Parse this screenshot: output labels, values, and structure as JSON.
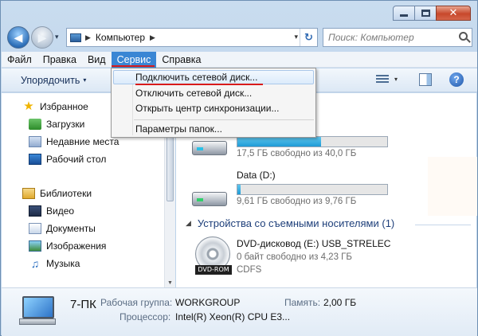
{
  "window": {
    "caption_min": "",
    "caption_max": "",
    "caption_close": "✕"
  },
  "nav": {
    "back_glyph": "◀",
    "fwd_glyph": "▶",
    "history_glyph": "▾",
    "address": {
      "path_sep": "▶",
      "location": "Компьютер",
      "after_sep": "▶",
      "drop_glyph": "▾"
    },
    "refresh_glyph": "↻",
    "search": {
      "placeholder": "Поиск: Компьютер"
    }
  },
  "menubar": {
    "items": [
      {
        "label": "Файл"
      },
      {
        "label": "Правка"
      },
      {
        "label": "Вид"
      },
      {
        "label": "Сервис"
      },
      {
        "label": "Справка"
      }
    ]
  },
  "toolbar": {
    "organize_label": "Упорядочить",
    "organize_arrow": "▾",
    "view_drop": "▾",
    "help_label": "?"
  },
  "navpane": {
    "favorites": "Избранное",
    "downloads": "Загрузки",
    "recent": "Недавние места",
    "desktop": "Рабочий стол",
    "libraries": "Библиотеки",
    "video": "Видео",
    "documents": "Документы",
    "images": "Изображения",
    "music": "Музыка",
    "star_glyph": "★",
    "music_glyph": "♫",
    "scroll_up": "▲",
    "scroll_down": "▼"
  },
  "content": {
    "drive_c": {
      "free_text": "17,5 ГБ свободно из 40,0 ГБ",
      "used_fraction": 0.56
    },
    "drive_d": {
      "label": "Data (D:)",
      "free_text": "9,61 ГБ свободно из 9,76 ГБ",
      "used_fraction": 0.02
    },
    "removable_header": "Устройства со съемными носителями (1)",
    "group_arrow": "◢",
    "dvd": {
      "label": "DVD-дисковод (E:) USB_STRELEC",
      "free_text": "0 байт свободно из 4,23 ГБ",
      "fs": "CDFS",
      "tag": "DVD-ROM"
    }
  },
  "dropdown": {
    "items": [
      {
        "label": "Подключить сетевой диск..."
      },
      {
        "label": "Отключить сетевой диск..."
      },
      {
        "label": "Открыть центр синхронизации..."
      },
      {
        "label": "Параметры папок..."
      }
    ]
  },
  "details": {
    "computer_name": "7-ПК",
    "workgroup_label": "Рабочая группа:",
    "workgroup_value": "WORKGROUP",
    "memory_label": "Память:",
    "memory_value": "2,00 ГБ",
    "cpu_label": "Процессор:",
    "cpu_value": "Intel(R) Xeon(R) CPU E3..."
  },
  "colors": {
    "menu_active": "#3a86d4",
    "annotation_red": "#d81b1b",
    "bar_fill": "#1f9bd6"
  }
}
